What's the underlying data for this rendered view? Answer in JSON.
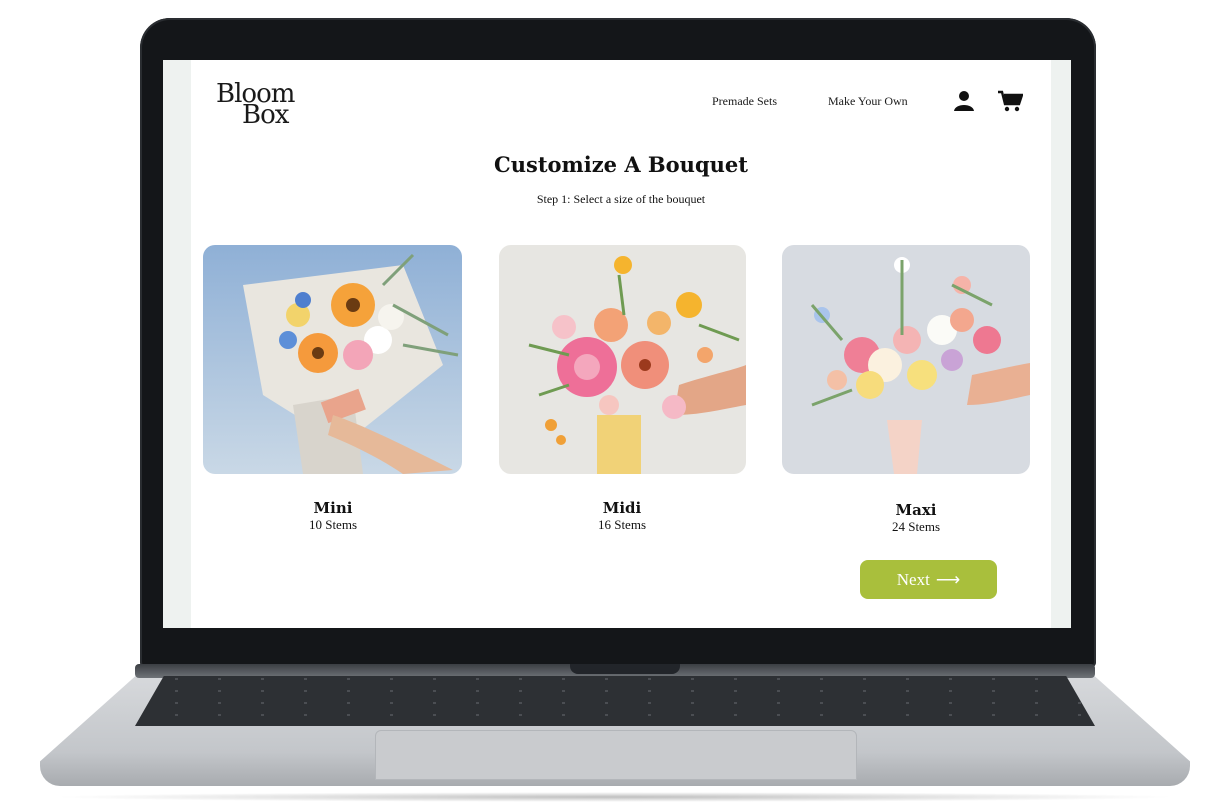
{
  "brand": {
    "line1": "Bloom",
    "line2": "Box"
  },
  "nav": {
    "premade_sets": "Premade Sets",
    "make_your_own": "Make Your Own"
  },
  "icons": {
    "account": "user-icon",
    "cart": "cart-icon",
    "next_arrow": "⟶"
  },
  "page": {
    "title": "Customize A Bouquet",
    "subtitle": "Step 1: Select a size of the bouquet"
  },
  "bouquets": [
    {
      "name": "Mini",
      "stems": "10 Stems"
    },
    {
      "name": "Midi",
      "stems": "16 Stems"
    },
    {
      "name": "Maxi",
      "stems": "24 Stems"
    }
  ],
  "next_button": {
    "label": "Next"
  },
  "colors": {
    "accent": "#a9bf3c",
    "text": "#111111",
    "laptop_frame": "#141619"
  }
}
